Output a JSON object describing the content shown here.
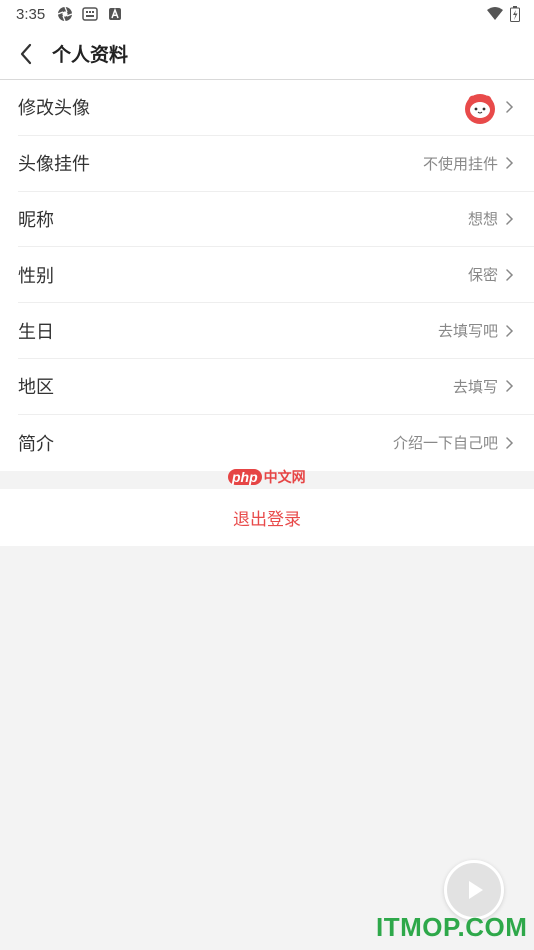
{
  "status_bar": {
    "time": "3:35"
  },
  "header": {
    "title": "个人资料"
  },
  "profile_rows": [
    {
      "label": "修改头像",
      "value": ""
    },
    {
      "label": "头像挂件",
      "value": "不使用挂件"
    },
    {
      "label": "昵称",
      "value": "想想"
    },
    {
      "label": "性别",
      "value": "保密"
    },
    {
      "label": "生日",
      "value": "去填写吧"
    },
    {
      "label": "地区",
      "value": "去填写"
    },
    {
      "label": "简介",
      "value": "介绍一下自己吧"
    }
  ],
  "watermark": {
    "php": "php",
    "cn": "中文网"
  },
  "logout": {
    "label": "退出登录"
  },
  "site_mark": {
    "text": "ITMOP.COM"
  },
  "colors": {
    "accent": "#e84a4a",
    "brand_green": "#2ea84a"
  }
}
